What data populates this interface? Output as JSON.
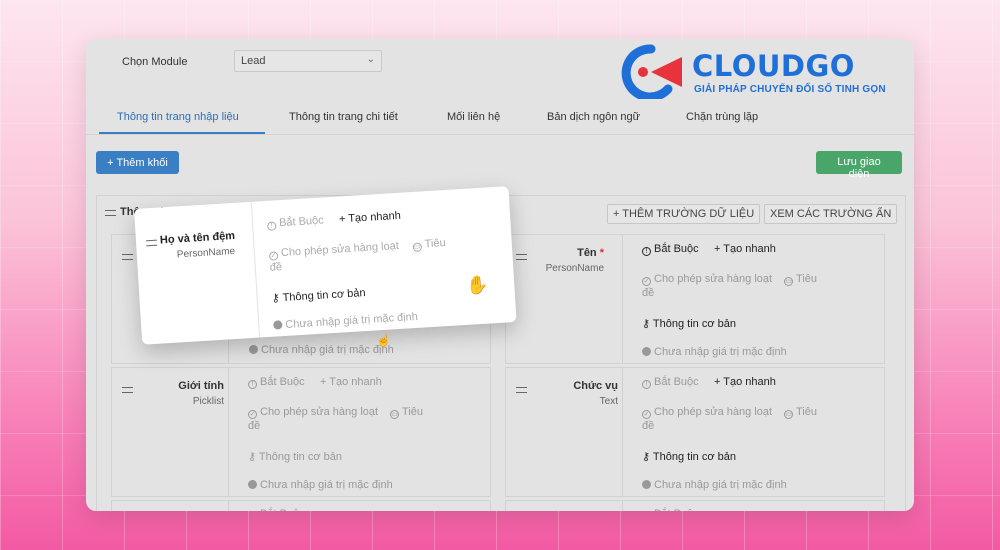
{
  "module": {
    "label": "Chọn Module",
    "value": "Lead"
  },
  "logo": {
    "word": "CLOUDGO",
    "tagline": "GIẢI PHÁP CHUYỂN ĐỔI SỐ TINH GỌN"
  },
  "tabs": [
    {
      "label": "Thông tin trang nhập liệu",
      "active": true
    },
    {
      "label": "Thông tin trang chi tiết"
    },
    {
      "label": "Mối liên hệ"
    },
    {
      "label": "Bản dịch ngôn ngữ"
    },
    {
      "label": "Chặn trùng lặp"
    }
  ],
  "toolbar": {
    "add_block": "+ Thêm khối",
    "save_layout": "Lưu giao diện"
  },
  "block": {
    "title": "Thông tin Lead",
    "add_field": "+ THÊM TRƯỜNG DỮ LIỆU",
    "view_hidden": "XEM CÁC TRƯỜNG ẨN"
  },
  "options": {
    "required": "Bắt Buộc",
    "quick_create": "+ Tạo nhanh",
    "mass_edit": "Cho phép sửa hàng loạt",
    "header": "Tiêu",
    "header_cont": "đề",
    "basic_info": "Thông tin cơ bản",
    "default_value": "Chưa nhập giá trị mặc định",
    "required_mark": "*"
  },
  "fields": [
    {
      "name": "Họ và tên đệm",
      "type": "PersonName"
    },
    {
      "name": "Tên",
      "type": "PersonName",
      "required": true
    },
    {
      "name": "Giới tính",
      "type": "Picklist"
    },
    {
      "name": "Chức vụ",
      "type": "Text"
    }
  ],
  "colors": {
    "accent": "#3a7fc3",
    "save": "#4aa56b",
    "brand": "#1f6fd9",
    "brand_red": "#e8323c"
  }
}
